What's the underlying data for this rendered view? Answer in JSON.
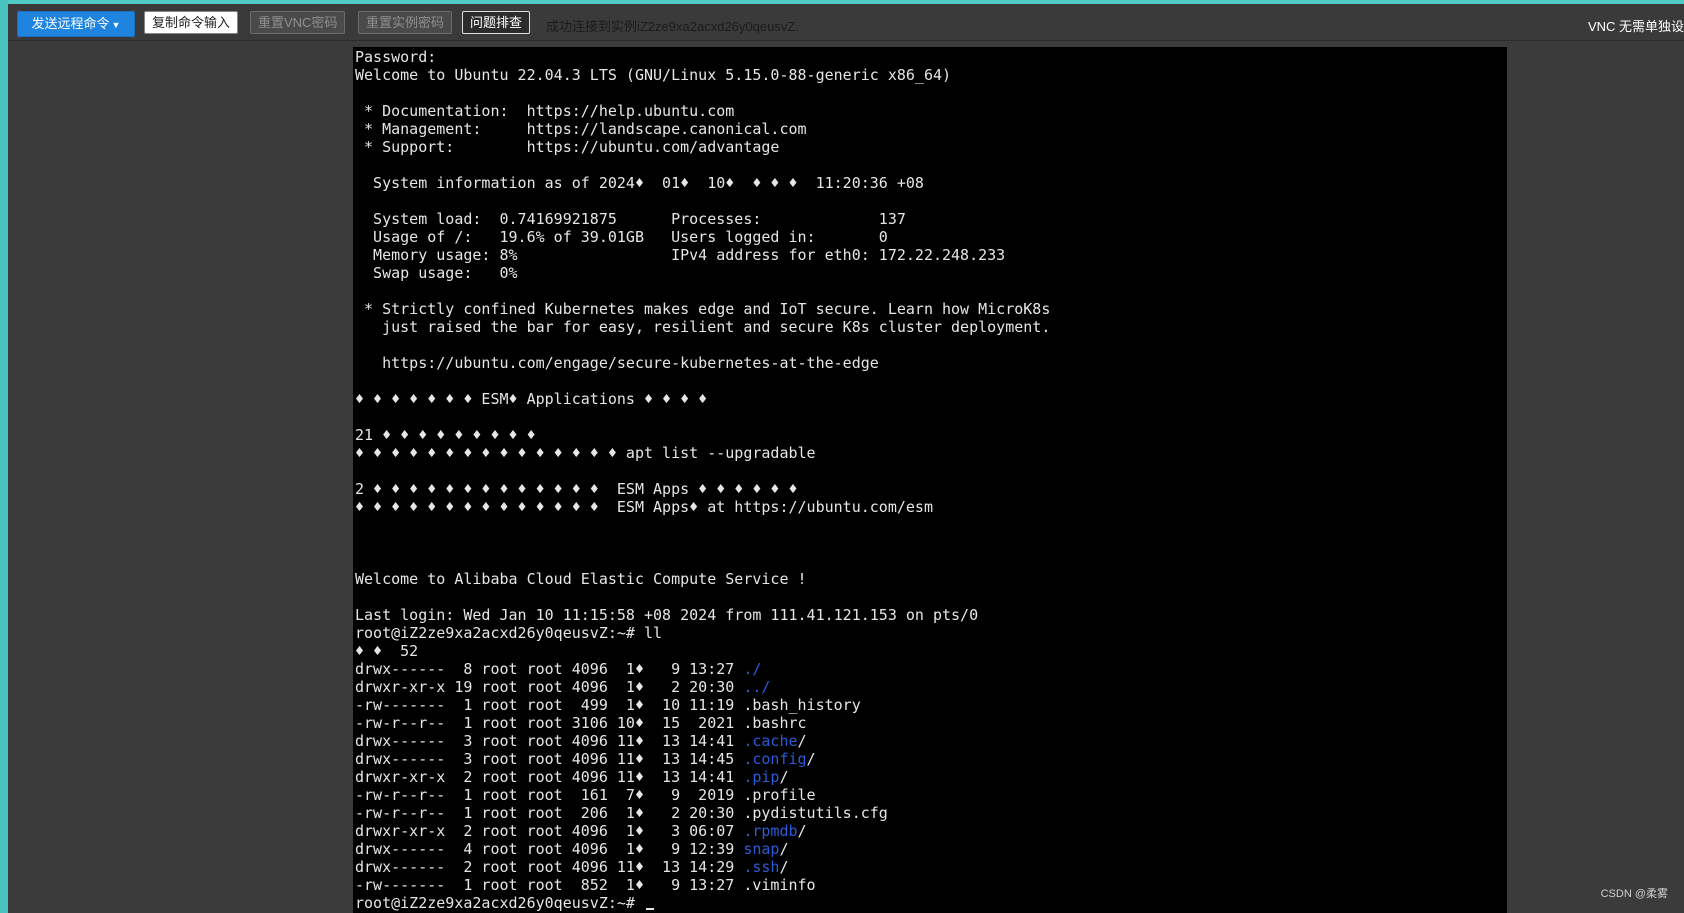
{
  "toolbar": {
    "send_command_label": "发送远程命令",
    "copy_input_label": "复制命令输入",
    "reset_vnc_label": "重置VNC密码",
    "reset_instance_label": "重置实例密码",
    "troubleshoot_label": "问题排查",
    "status_message": "成功连接到实例iZ2ze9xa2acxd26y0qeusvZ.",
    "vnc_note": "VNC 无需单独设"
  },
  "colors": {
    "accent": "#4ec9c3",
    "primary_button": "#1e84e0",
    "terminal_bg": "#000000",
    "terminal_text": "#e6e6e6",
    "terminal_link": "#2a5bd8"
  },
  "terminal": {
    "lines": [
      [
        "Password:"
      ],
      [
        "Welcome to Ubuntu 22.04.3 LTS (GNU/Linux 5.15.0-88-generic x86_64)"
      ],
      [
        ""
      ],
      [
        " * Documentation:  https://help.ubuntu.com"
      ],
      [
        " * Management:     https://landscape.canonical.com"
      ],
      [
        " * Support:        https://ubuntu.com/advantage"
      ],
      [
        ""
      ],
      [
        "  System information as of 2024♦  01♦  10♦  ♦ ♦ ♦  11:20:36 +08"
      ],
      [
        ""
      ],
      [
        "  System load:  0.74169921875      Processes:             137"
      ],
      [
        "  Usage of /:   19.6% of 39.01GB   Users logged in:       0"
      ],
      [
        "  Memory usage: 8%                 IPv4 address for eth0: 172.22.248.233"
      ],
      [
        "  Swap usage:   0%"
      ],
      [
        ""
      ],
      [
        " * Strictly confined Kubernetes makes edge and IoT secure. Learn how MicroK8s"
      ],
      [
        "   just raised the bar for easy, resilient and secure K8s cluster deployment."
      ],
      [
        ""
      ],
      [
        "   https://ubuntu.com/engage/secure-kubernetes-at-the-edge"
      ],
      [
        ""
      ],
      [
        "♦ ♦ ♦ ♦ ♦ ♦ ♦ ESM♦ Applications ♦ ♦ ♦ ♦"
      ],
      [
        ""
      ],
      [
        "21 ♦ ♦ ♦ ♦ ♦ ♦ ♦ ♦ ♦"
      ],
      [
        "♦ ♦ ♦ ♦ ♦ ♦ ♦ ♦ ♦ ♦ ♦ ♦ ♦ ♦ ♦ apt list --upgradable"
      ],
      [
        ""
      ],
      [
        "2 ♦ ♦ ♦ ♦ ♦ ♦ ♦ ♦ ♦ ♦ ♦ ♦ ♦  ESM Apps ♦ ♦ ♦ ♦ ♦ ♦"
      ],
      [
        "♦ ♦ ♦ ♦ ♦ ♦ ♦ ♦ ♦ ♦ ♦ ♦ ♦ ♦  ESM Apps♦ at https://ubuntu.com/esm"
      ],
      [
        ""
      ],
      [
        ""
      ],
      [
        ""
      ],
      [
        "Welcome to Alibaba Cloud Elastic Compute Service !"
      ],
      [
        ""
      ],
      [
        "Last login: Wed Jan 10 11:15:58 +08 2024 from 111.41.121.153 on pts/0"
      ],
      [
        "root@iZ2ze9xa2acxd26y0qeusvZ:~# ll"
      ],
      [
        "♦ ♦  52"
      ],
      [
        "drwx------  8 root root 4096  1♦   9 13:27 ",
        {
          "link": "./"
        }
      ],
      [
        "drwxr-xr-x 19 root root 4096  1♦   2 20:30 ",
        {
          "link": "../"
        }
      ],
      [
        "-rw-------  1 root root  499  1♦  10 11:19 .bash_history"
      ],
      [
        "-rw-r--r--  1 root root 3106 10♦  15  2021 .bashrc"
      ],
      [
        "drwx------  3 root root 4096 11♦  13 14:41 ",
        {
          "link": ".cache"
        },
        "/"
      ],
      [
        "drwx------  3 root root 4096 11♦  13 14:45 ",
        {
          "link": ".config"
        },
        "/"
      ],
      [
        "drwxr-xr-x  2 root root 4096 11♦  13 14:41 ",
        {
          "link": ".pip"
        },
        "/"
      ],
      [
        "-rw-r--r--  1 root root  161  7♦   9  2019 .profile"
      ],
      [
        "-rw-r--r--  1 root root  206  1♦   2 20:30 .pydistutils.cfg"
      ],
      [
        "drwxr-xr-x  2 root root 4096  1♦   3 06:07 ",
        {
          "link": ".rpmdb"
        },
        "/"
      ],
      [
        "drwx------  4 root root 4096  1♦   9 12:39 ",
        {
          "link": "snap"
        },
        "/"
      ],
      [
        "drwx------  2 root root 4096 11♦  13 14:29 ",
        {
          "link": ".ssh"
        },
        "/"
      ],
      [
        "-rw-------  1 root root  852  1♦   9 13:27 .viminfo"
      ],
      [
        "root@iZ2ze9xa2acxd26y0qeusvZ:~# ",
        {
          "cursor": true
        }
      ]
    ]
  },
  "watermark": "CSDN @柔雾"
}
